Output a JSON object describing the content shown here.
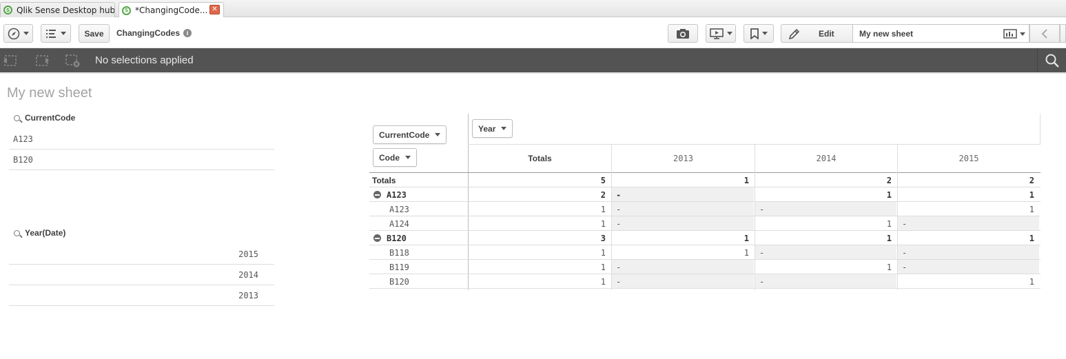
{
  "tabs": [
    {
      "label": "Qlik Sense Desktop hub"
    },
    {
      "label": "*ChangingCode..."
    }
  ],
  "toolbar": {
    "save_label": "Save",
    "app_name": "ChangingCodes",
    "edit_label": "Edit",
    "sheet_selector": "My new sheet"
  },
  "selections": {
    "text": "No selections applied"
  },
  "sheet": {
    "title": "My new sheet"
  },
  "filters": [
    {
      "title": "CurrentCode",
      "values": [
        "A123",
        "B120"
      ]
    },
    {
      "title": "Year(Date)",
      "values": [
        "2015",
        "2014",
        "2013"
      ]
    }
  ],
  "pivot": {
    "row_dims": [
      "CurrentCode",
      "Code"
    ],
    "col_dim": "Year",
    "col_headers": [
      "Totals",
      "2013",
      "2014",
      "2015"
    ],
    "totals_row": {
      "label": "Totals",
      "values": [
        "5",
        "1",
        "2",
        "2"
      ]
    },
    "groups": [
      {
        "label": "A123",
        "values": [
          "2",
          "-",
          "1",
          "1"
        ],
        "rows": [
          {
            "label": "A123",
            "values": [
              "1",
              "-",
              "-",
              "1"
            ]
          },
          {
            "label": "A124",
            "values": [
              "1",
              "-",
              "1",
              "-"
            ]
          }
        ]
      },
      {
        "label": "B120",
        "values": [
          "3",
          "1",
          "1",
          "1"
        ],
        "rows": [
          {
            "label": "B118",
            "values": [
              "1",
              "1",
              "-",
              "-"
            ]
          },
          {
            "label": "B119",
            "values": [
              "1",
              "-",
              "1",
              "-"
            ]
          },
          {
            "label": "B120",
            "values": [
              "1",
              "-",
              "-",
              "1"
            ]
          }
        ]
      }
    ]
  }
}
